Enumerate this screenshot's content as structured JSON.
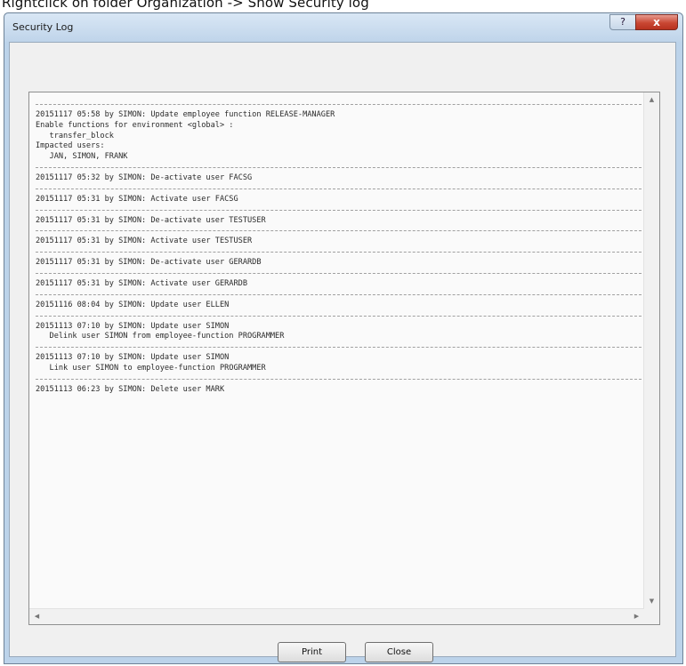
{
  "caption": "Rightclick on folder Organization -> Show Security log",
  "window": {
    "title": "Security Log",
    "help_symbol": "?",
    "close_symbol": "x"
  },
  "log_entries": [
    {
      "lines": [
        "20151117 05:58 by SIMON: Update employee function RELEASE-MANAGER",
        "Enable functions for environment <global> :",
        "   transfer_block",
        "Impacted users:",
        "   JAN, SIMON, FRANK"
      ]
    },
    {
      "lines": [
        "20151117 05:32 by SIMON: De-activate user FACSG"
      ]
    },
    {
      "lines": [
        "20151117 05:31 by SIMON: Activate user FACSG"
      ]
    },
    {
      "lines": [
        "20151117 05:31 by SIMON: De-activate user TESTUSER"
      ]
    },
    {
      "lines": [
        "20151117 05:31 by SIMON: Activate user TESTUSER"
      ]
    },
    {
      "lines": [
        "20151117 05:31 by SIMON: De-activate user GERARDB"
      ]
    },
    {
      "lines": [
        "20151117 05:31 by SIMON: Activate user GERARDB"
      ]
    },
    {
      "lines": [
        "20151116 08:04 by SIMON: Update user ELLEN"
      ]
    },
    {
      "lines": [
        "20151113 07:10 by SIMON: Update user SIMON",
        "   Delink user SIMON from employee-function PROGRAMMER"
      ]
    },
    {
      "lines": [
        "20151113 07:10 by SIMON: Update user SIMON",
        "   Link user SIMON to employee-function PROGRAMMER"
      ]
    },
    {
      "lines": [
        "20151113 06:23 by SIMON: Delete user MARK"
      ]
    }
  ],
  "buttons": {
    "print": "Print",
    "close": "Close"
  }
}
